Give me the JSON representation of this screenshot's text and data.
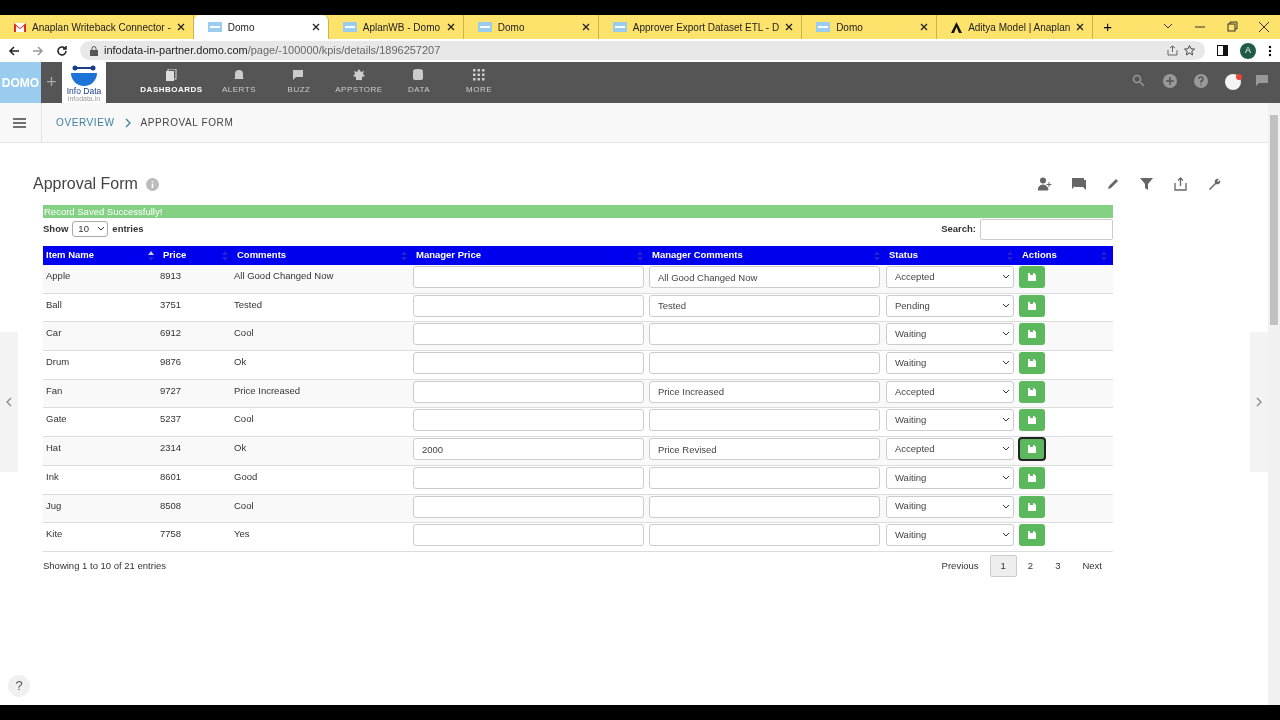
{
  "browser": {
    "tabs": [
      {
        "title": "Anaplan Writeback Connector -",
        "selected": false
      },
      {
        "title": "Domo",
        "selected": true
      },
      {
        "title": "AplanWB - Domo",
        "selected": false
      },
      {
        "title": "Domo",
        "selected": false
      },
      {
        "title": "Approver Export Dataset ETL - D",
        "selected": false
      },
      {
        "title": "Domo",
        "selected": false
      },
      {
        "title": "Aditya Model | Anaplan",
        "selected": false
      }
    ],
    "new_tab": "+",
    "url_host": "infodata-in-partner.domo.com",
    "url_path": "/page/-100000/kpis/details/1896257207",
    "profile": "A"
  },
  "app": {
    "logo": "DOMO",
    "add": "+",
    "brand": "Info Data",
    "brand_sub": "infodata.in",
    "nav": [
      {
        "label": "DASHBOARDS",
        "selected": true
      },
      {
        "label": "ALERTS",
        "selected": false
      },
      {
        "label": "BUZZ",
        "selected": false
      },
      {
        "label": "APPSTORE",
        "selected": false
      },
      {
        "label": "DATA",
        "selected": false
      },
      {
        "label": "MORE",
        "selected": false
      }
    ],
    "breadcrumb": [
      "OVERVIEW",
      "APPROVAL FORM"
    ]
  },
  "page": {
    "title": "Approval Form",
    "alert": "Record Saved Successfully!",
    "show_label": "Show",
    "length": "10",
    "entries_label": "entries",
    "search_label": "Search:",
    "columns": [
      {
        "label": "Item Name",
        "sorted": true
      },
      {
        "label": "Price",
        "sorted": false
      },
      {
        "label": "Comments",
        "sorted": false
      },
      {
        "label": "Manager Price",
        "sorted": false
      },
      {
        "label": "Manager Comments",
        "sorted": false
      },
      {
        "label": "Status",
        "sorted": false
      },
      {
        "label": "Actions",
        "sorted": false
      }
    ],
    "rows": [
      {
        "item": "Apple",
        "price": "8913",
        "comments": "All Good Changed Now",
        "manager_comments": "All Good Changed Now",
        "status": "Accepted",
        "focused": false
      },
      {
        "item": "Ball",
        "price": "3751",
        "comments": "Tested",
        "manager_comments": "Tested",
        "status": "Pending",
        "focused": false
      },
      {
        "item": "Car",
        "price": "6912",
        "comments": "Cool",
        "status": "Waiting",
        "focused": false
      },
      {
        "item": "Drum",
        "price": "9876",
        "comments": "Ok",
        "status": "Waiting",
        "focused": false
      },
      {
        "item": "Fan",
        "price": "9727",
        "comments": "Price Increased",
        "manager_comments": "Price Increased",
        "status": "Accepted",
        "focused": false
      },
      {
        "item": "Gate",
        "price": "5237",
        "comments": "Cool",
        "status": "Waiting",
        "focused": false
      },
      {
        "item": "Hat",
        "price": "2314",
        "comments": "Ok",
        "manager_price": "2000",
        "manager_comments": "Price Revised",
        "status": "Accepted",
        "focused": true
      },
      {
        "item": "Ink",
        "price": "8601",
        "comments": "Good",
        "status": "Waiting",
        "focused": false
      },
      {
        "item": "Jug",
        "price": "8508",
        "comments": "Cool",
        "status": "Waiting",
        "focused": false
      },
      {
        "item": "Kite",
        "price": "7758",
        "comments": "Yes",
        "status": "Waiting",
        "focused": false
      }
    ],
    "info": "Showing 1 to 10 of 21 entries",
    "pages": [
      {
        "label": "Previous",
        "selected": false
      },
      {
        "label": "1",
        "selected": true
      },
      {
        "label": "2",
        "selected": false
      },
      {
        "label": "3",
        "selected": false
      },
      {
        "label": "Next",
        "selected": false
      }
    ]
  },
  "help": "?"
}
